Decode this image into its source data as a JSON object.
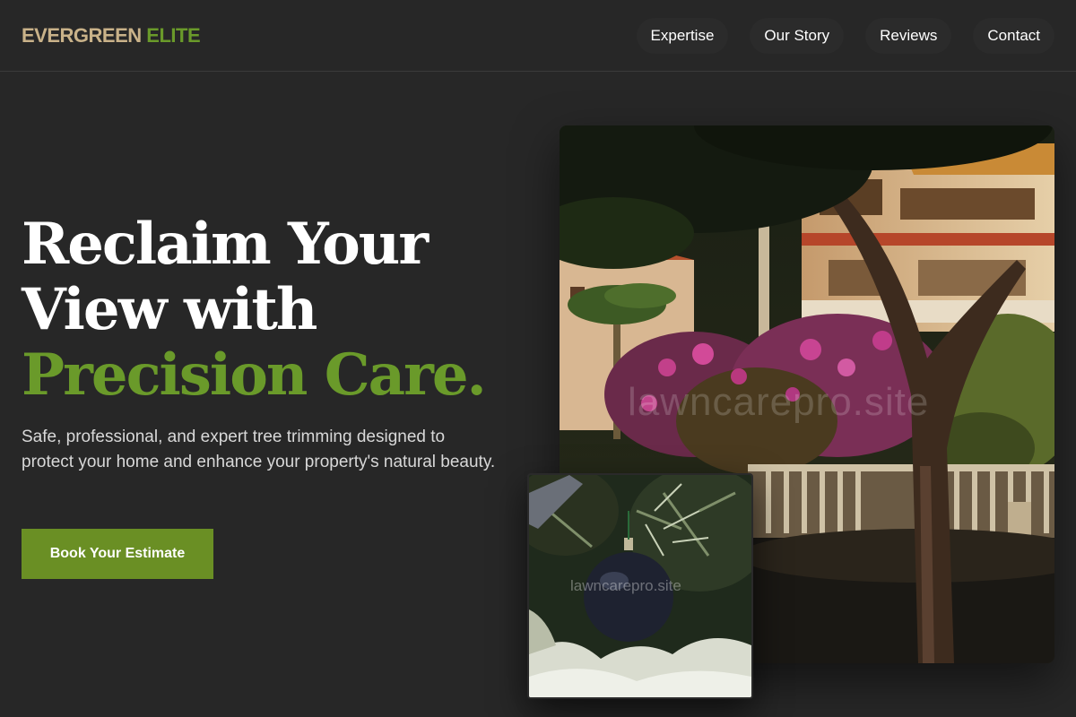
{
  "header": {
    "logo_part1": "EVERGREEN",
    "logo_part2": "ELITE",
    "nav": [
      "Expertise",
      "Our Story",
      "Reviews",
      "Contact"
    ]
  },
  "hero": {
    "headline_line1": "Reclaim Your",
    "headline_line2": "View with",
    "headline_line3": "Precision Care.",
    "subtext": "Safe, professional, and expert tree trimming designed to protect your home and enhance your property's natural beauty.",
    "cta": "Book Your Estimate"
  },
  "images": {
    "main_watermark": "lawncarepro.site",
    "inset_watermark": "lawncarepro.site"
  },
  "colors": {
    "background": "#272727",
    "accent_green": "#6a9a2a",
    "logo_tan": "#c9b289",
    "button_green": "#6a8f24"
  }
}
